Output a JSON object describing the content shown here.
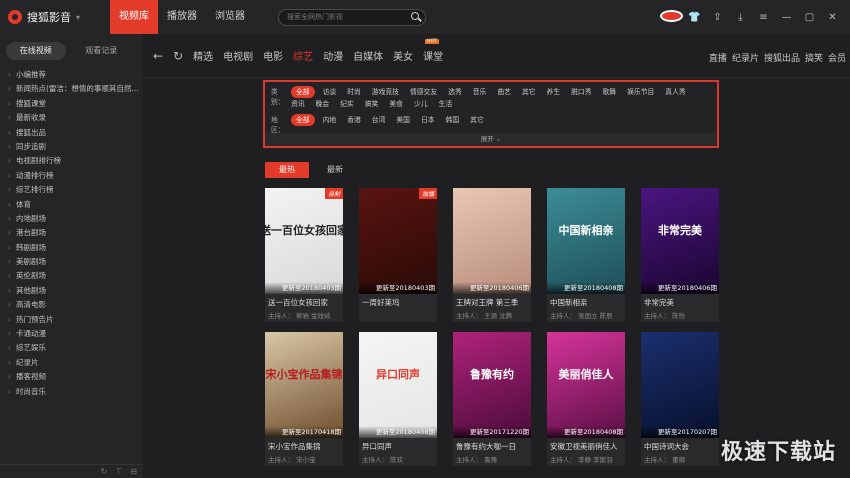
{
  "app": {
    "name": "搜狐影音",
    "nav_tabs": [
      "视频库",
      "播放器",
      "浏览器"
    ],
    "search_placeholder": "搜索全网热门影视"
  },
  "sidebar": {
    "tabs": [
      "在线视频",
      "观看记录"
    ],
    "items": [
      "小编推荐",
      "新闻热点(雷洁：想情的事顺其自然…",
      "搜狐课堂",
      "最新收录",
      "搜狐出品",
      "同步追剧",
      "电视剧排行榜",
      "动漫排行榜",
      "综艺排行榜",
      "体育",
      "内地剧场",
      "港台剧场",
      "韩剧剧场",
      "美剧剧场",
      "英伦剧场",
      "其他剧场",
      "高清电影",
      "热门预告片",
      "卡通动漫",
      "综艺娱乐",
      "纪录片",
      "播客视频",
      "时尚音乐"
    ]
  },
  "categories": {
    "items": [
      "精选",
      "电视剧",
      "电影",
      "综艺",
      "动漫",
      "自媒体",
      "美女",
      "课堂"
    ],
    "课堂_badge": "HOT",
    "right": [
      "直播",
      "纪录片",
      "搜狐出品",
      "搞笑",
      "会员"
    ]
  },
  "filters": {
    "type_label": "类别：",
    "type_options": [
      "全部",
      "访谈",
      "时尚",
      "游戏竞技",
      "情感交友",
      "选秀",
      "音乐",
      "曲艺",
      "其它",
      "养生",
      "脱口秀",
      "歌舞",
      "娱乐节目",
      "真人秀",
      "资讯",
      "晚会",
      "纪实",
      "搞笑",
      "美食",
      "少儿",
      "生活"
    ],
    "region_label": "地区：",
    "region_options": [
      "全部",
      "内地",
      "香港",
      "台湾",
      "美国",
      "日本",
      "韩国",
      "其它"
    ],
    "expand_label": "展开 ⌄"
  },
  "sort": [
    "最热",
    "最新"
  ],
  "cards": [
    {
      "title": "送一百位女孩回家",
      "host": "主持人：  柳岩 金玟岐",
      "update": "更新至20180403期",
      "art": "送一百位女孩回家",
      "badge": "自制",
      "bg1": "#f3f3f3",
      "bg2": "#d9d9d9",
      "fg": "#222"
    },
    {
      "title": "一周好莱坞",
      "host": "",
      "update": "更新至20180403期",
      "art": "",
      "badge": "独播",
      "bg1": "#5a1410",
      "bg2": "#2a0a08",
      "fg": "#fff"
    },
    {
      "title": "王牌对王牌 第三季",
      "host": "主持人：  王源 沈腾",
      "update": "更新至20180406期",
      "art": "",
      "badge": "",
      "bg1": "#e9c7b5",
      "bg2": "#b88d7c",
      "fg": "#fff"
    },
    {
      "title": "中国新相亲",
      "host": "主持人：  张国立 陈辰",
      "update": "更新至20180408期",
      "art": "中国新相亲",
      "badge": "",
      "bg1": "#3c8d96",
      "bg2": "#1e4e58",
      "fg": "#fff"
    },
    {
      "title": "非常完美",
      "host": "主持人：  陈怡",
      "update": "更新至20180406期",
      "art": "非常完美",
      "badge": "",
      "bg1": "#4a1580",
      "bg2": "#1a0630",
      "fg": "#fff"
    },
    {
      "title": "宋小宝作品集锦",
      "host": "主持人：  宋小宝",
      "update": "更新至20170418期",
      "art": "宋小宝作品集锦",
      "badge": "",
      "bg1": "#d9c7a8",
      "bg2": "#6f4e2d",
      "fg": "#b81d1d"
    },
    {
      "title": "异口同声",
      "host": "主持人：  陈欢",
      "update": "更新至20180408期",
      "art": "异口同声",
      "badge": "",
      "bg1": "#f5f5f5",
      "bg2": "#e5e5e5",
      "fg": "#e23b2a"
    },
    {
      "title": "鲁豫有约大咖一日",
      "host": "主持人：  鲁豫",
      "update": "更新至20171220期",
      "art": "鲁豫有约",
      "badge": "",
      "bg1": "#b0227a",
      "bg2": "#4a0c3a",
      "fg": "#fff"
    },
    {
      "title": "安徽卫视美丽俏佳人",
      "host": "主持人：  李静 李斯羽",
      "update": "更新至20180408期",
      "art": "美丽俏佳人",
      "badge": "",
      "bg1": "#d6349a",
      "bg2": "#5a0f44",
      "fg": "#fff"
    },
    {
      "title": "中国诗词大会",
      "host": "主持人：  董卿",
      "update": "更新至20170207期",
      "art": "",
      "badge": "",
      "bg1": "#1b2f6e",
      "bg2": "#07102b",
      "fg": "#fff"
    }
  ],
  "watermark": "极速下载站"
}
